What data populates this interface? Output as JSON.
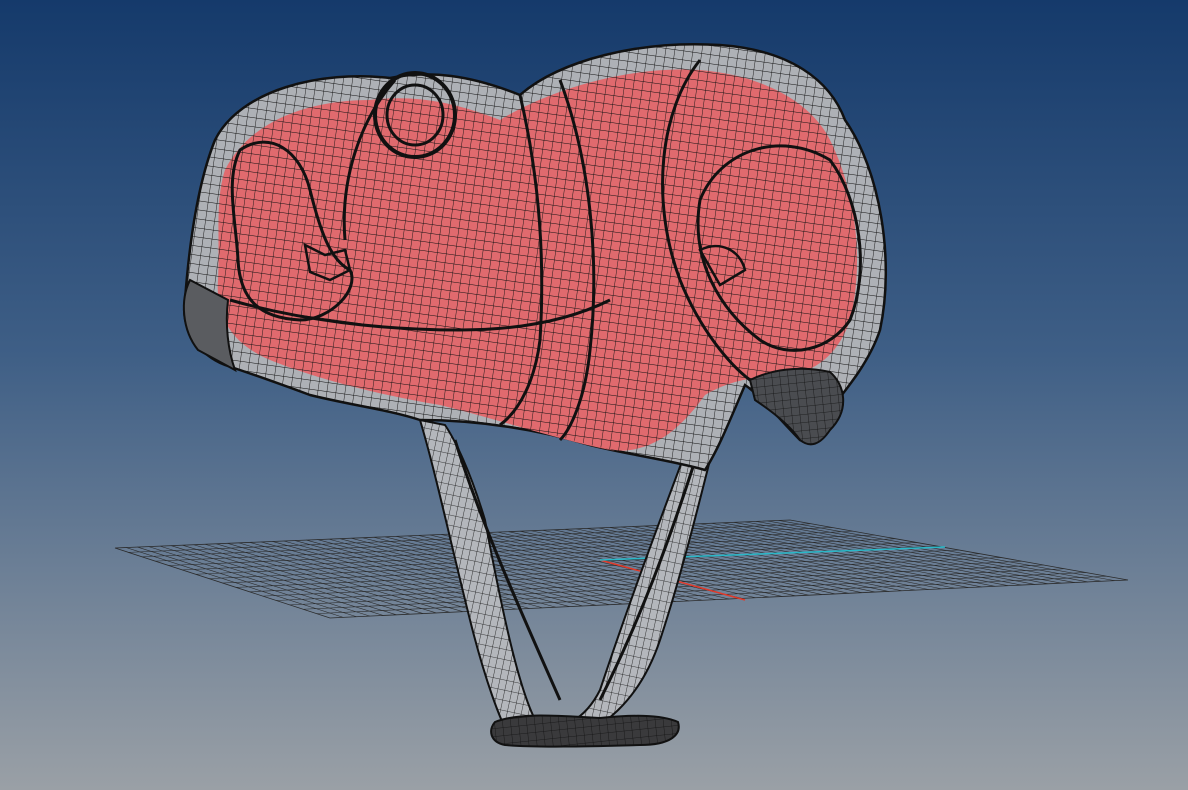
{
  "viewport": {
    "background_top": "#153a6b",
    "background_bottom": "#9aa0a6",
    "axes": {
      "x_color": "#e03a2a",
      "y_color": "#2ab8c8"
    },
    "model": {
      "wire_color": "#111111",
      "surface_color": "#b0b3b8",
      "selection_color": "#e06a6e"
    },
    "ground_grid": {
      "line_color": "#2a2a2a"
    }
  }
}
